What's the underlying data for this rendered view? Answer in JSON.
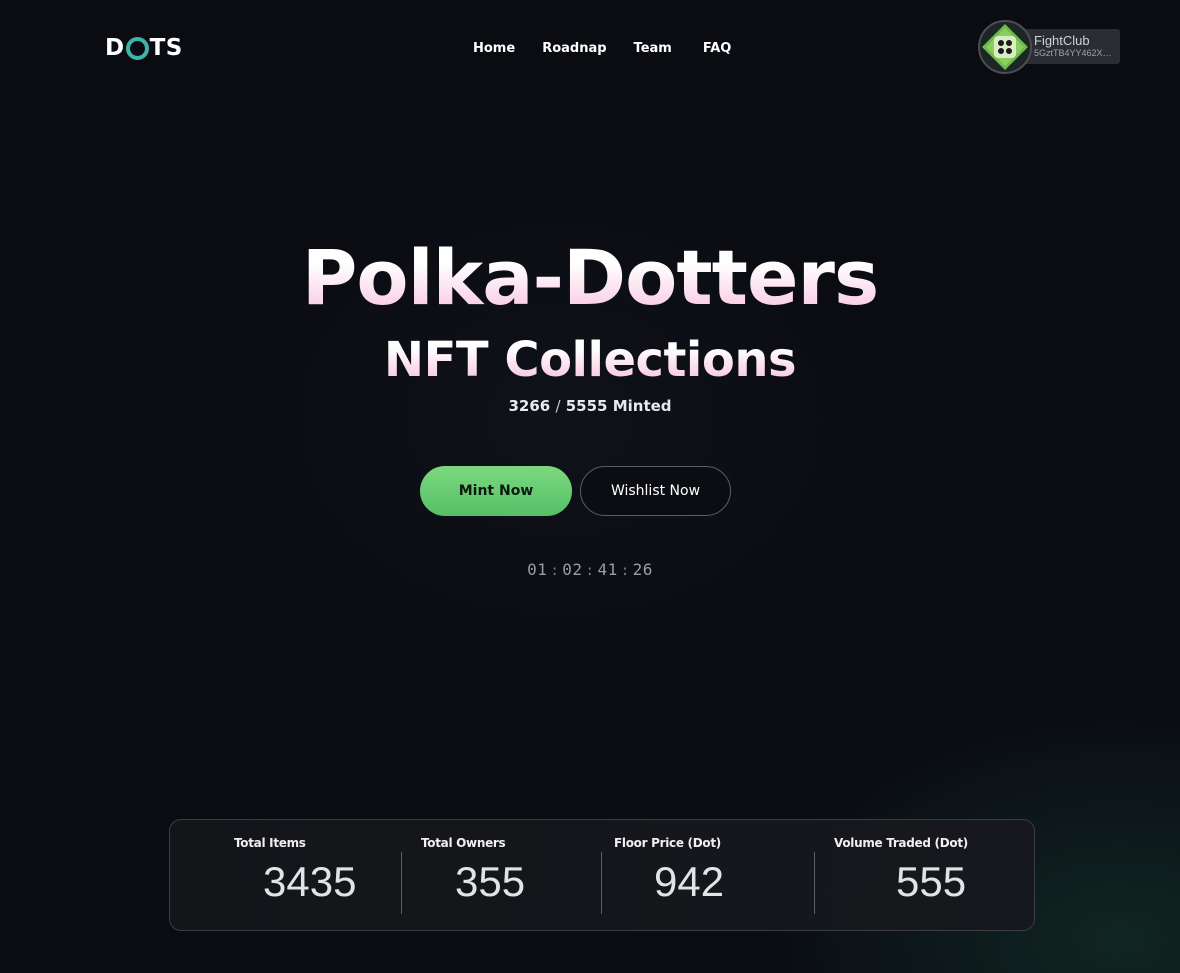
{
  "brand": {
    "logo_left": "D",
    "logo_right": "TS",
    "accent_color": "#3fb3a8"
  },
  "nav": {
    "items": [
      "Home",
      "Roadnap",
      "Team",
      "FAQ"
    ]
  },
  "wallet": {
    "name": "FightClub",
    "address": "5GztTB4YY462XQY...",
    "avatar_icon": "dice-four-icon"
  },
  "hero": {
    "title": "Polka-Dotters",
    "subtitle": "NFT Collections",
    "minted_count": "3266",
    "minted_separator": "/",
    "minted_total": "5555",
    "minted_label": "Minted"
  },
  "actions": {
    "mint_label": "Mint Now",
    "wishlist_label": "Wishlist Now",
    "mint_color": "#67cc73"
  },
  "countdown": {
    "days": "01",
    "hours": "02",
    "minutes": "41",
    "seconds": "26"
  },
  "stats": [
    {
      "label": "Total Items",
      "value": "3435"
    },
    {
      "label": "Total Owners",
      "value": "355"
    },
    {
      "label": "Floor Price (Dot)",
      "value": "942"
    },
    {
      "label": "Volume Traded (Dot)",
      "value": "555"
    }
  ]
}
